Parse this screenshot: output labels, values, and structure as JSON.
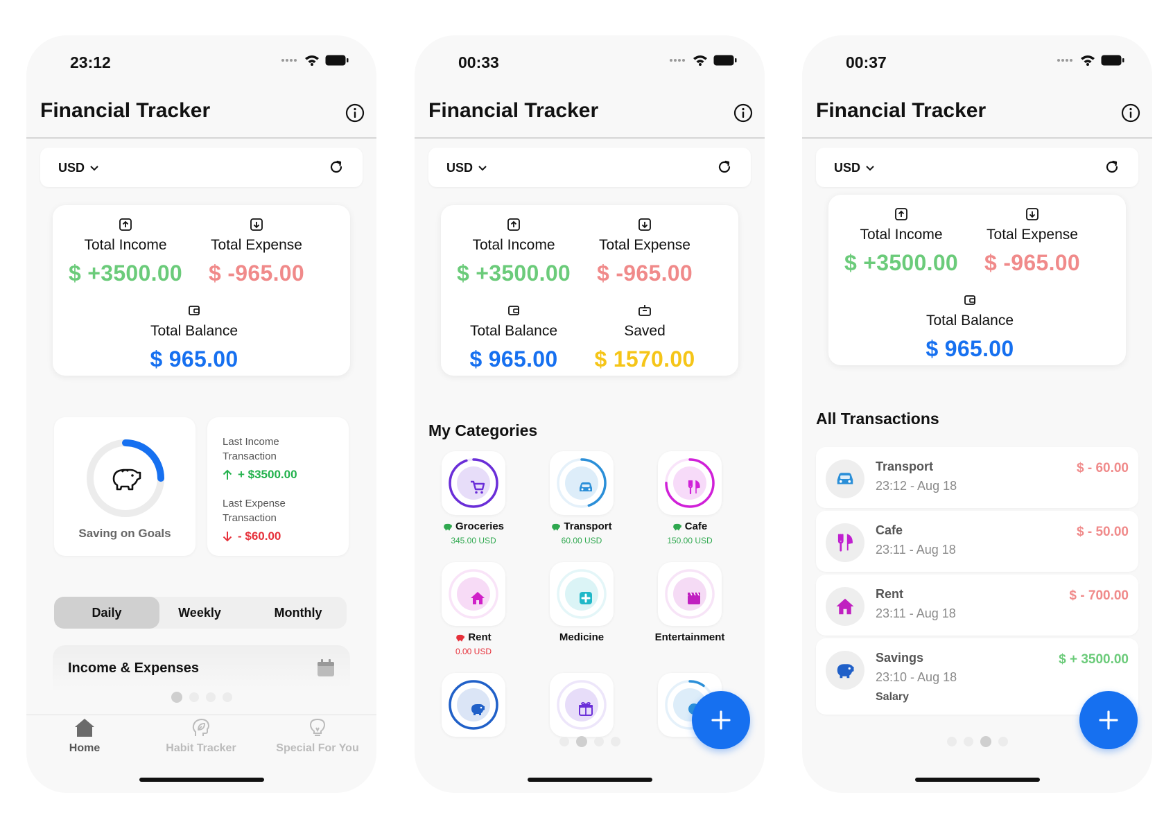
{
  "app": {
    "title": "Financial Tracker",
    "currency": "USD"
  },
  "colors": {
    "accent": "#1670f0",
    "income": "#6bcb7a",
    "expense": "#f08a8a",
    "balance": "#1670f0",
    "saved": "#f5c518",
    "strong_green": "#22b14c",
    "strong_red": "#e6303a"
  },
  "screens": {
    "home": {
      "time": "23:12",
      "summary": {
        "income_label": "Total Income",
        "income_value": "$ +3500.00",
        "expense_label": "Total Expense",
        "expense_value": "$ -965.00",
        "balance_label": "Total Balance",
        "balance_value": "$ 965.00"
      },
      "goals": {
        "label": "Saving on Goals",
        "progress": 0.25
      },
      "last": {
        "income_label": "Last Income Transaction",
        "income_value": "+ $3500.00",
        "expense_label": "Last Expense Transaction",
        "expense_value": "- $60.00"
      },
      "periods": [
        "Daily",
        "Weekly",
        "Monthly"
      ],
      "selected_period": "Daily",
      "chart_card_title": "Income & Expenses",
      "nav": [
        {
          "label": "Home",
          "icon": "house-icon",
          "active": true
        },
        {
          "label": "Habit Tracker",
          "icon": "brain-leaf-icon",
          "active": false
        },
        {
          "label": "Special For You",
          "icon": "lightbulb-icon",
          "active": false
        }
      ]
    },
    "categories": {
      "time": "00:33",
      "summary": {
        "income_label": "Total Income",
        "income_value": "$ +3500.00",
        "expense_label": "Total Expense",
        "expense_value": "$ -965.00",
        "balance_label": "Total Balance",
        "balance_value": "$ 965.00",
        "saved_label": "Saved",
        "saved_value": "$ 1570.00"
      },
      "section_title": "My Categories",
      "items": [
        {
          "name": "Groceries",
          "amount": "345.00 USD",
          "icon": "cart-icon",
          "color": "#6a2ed8",
          "progress": 0.95,
          "amount_color": "#2fa84f",
          "badge": "green"
        },
        {
          "name": "Transport",
          "amount": "60.00 USD",
          "icon": "car-icon",
          "color": "#2b8fd8",
          "progress": 0.45,
          "amount_color": "#2fa84f",
          "badge": "green"
        },
        {
          "name": "Cafe",
          "amount": "150.00 USD",
          "icon": "fork-knife-icon",
          "color": "#d020d8",
          "progress": 0.75,
          "amount_color": "#2fa84f",
          "badge": "green"
        },
        {
          "name": "Rent",
          "amount": "0.00 USD",
          "icon": "house-icon",
          "color": "#d020c8",
          "progress": 0,
          "amount_color": "#e6303a",
          "badge": "red"
        },
        {
          "name": "Medicine",
          "amount": "",
          "icon": "medical-cross-icon",
          "color": "#20b8c8",
          "progress": 0,
          "amount_color": "#2fa84f",
          "badge": ""
        },
        {
          "name": "Entertainment",
          "amount": "",
          "icon": "clapperboard-icon",
          "color": "#c020c0",
          "progress": 0,
          "amount_color": "#2fa84f",
          "badge": ""
        },
        {
          "name": "",
          "amount": "",
          "icon": "piggy-bank-icon",
          "color": "#2060c8",
          "progress": 1,
          "amount_color": "#2fa84f",
          "badge": ""
        },
        {
          "name": "",
          "amount": "",
          "icon": "gift-icon",
          "color": "#6a2ed8",
          "progress": 0,
          "amount_color": "#2fa84f",
          "badge": ""
        },
        {
          "name": "",
          "amount": "",
          "icon": "category-icon",
          "color": "#2b8fd8",
          "progress": 0.1,
          "amount_color": "#2fa84f",
          "badge": ""
        }
      ]
    },
    "transactions": {
      "time": "00:37",
      "summary": {
        "income_label": "Total Income",
        "income_value": "$ +3500.00",
        "expense_label": "Total Expense",
        "expense_value": "$ -965.00",
        "balance_label": "Total Balance",
        "balance_value": "$ 965.00"
      },
      "section_title": "All Transactions",
      "items": [
        {
          "name": "Transport",
          "time": "23:12 - Aug 18",
          "amount": "$ - 60.00",
          "type": "expense",
          "icon": "car-icon",
          "note": ""
        },
        {
          "name": "Cafe",
          "time": "23:11 - Aug 18",
          "amount": "$ - 50.00",
          "type": "expense",
          "icon": "fork-knife-icon",
          "note": ""
        },
        {
          "name": "Rent",
          "time": "23:11 - Aug 18",
          "amount": "$ - 700.00",
          "type": "expense",
          "icon": "house-icon",
          "note": ""
        },
        {
          "name": "Savings",
          "time": "23:10 - Aug 18",
          "amount": "$ + 3500.00",
          "type": "income",
          "icon": "piggy-bank-icon",
          "note": "Salary"
        }
      ]
    }
  }
}
